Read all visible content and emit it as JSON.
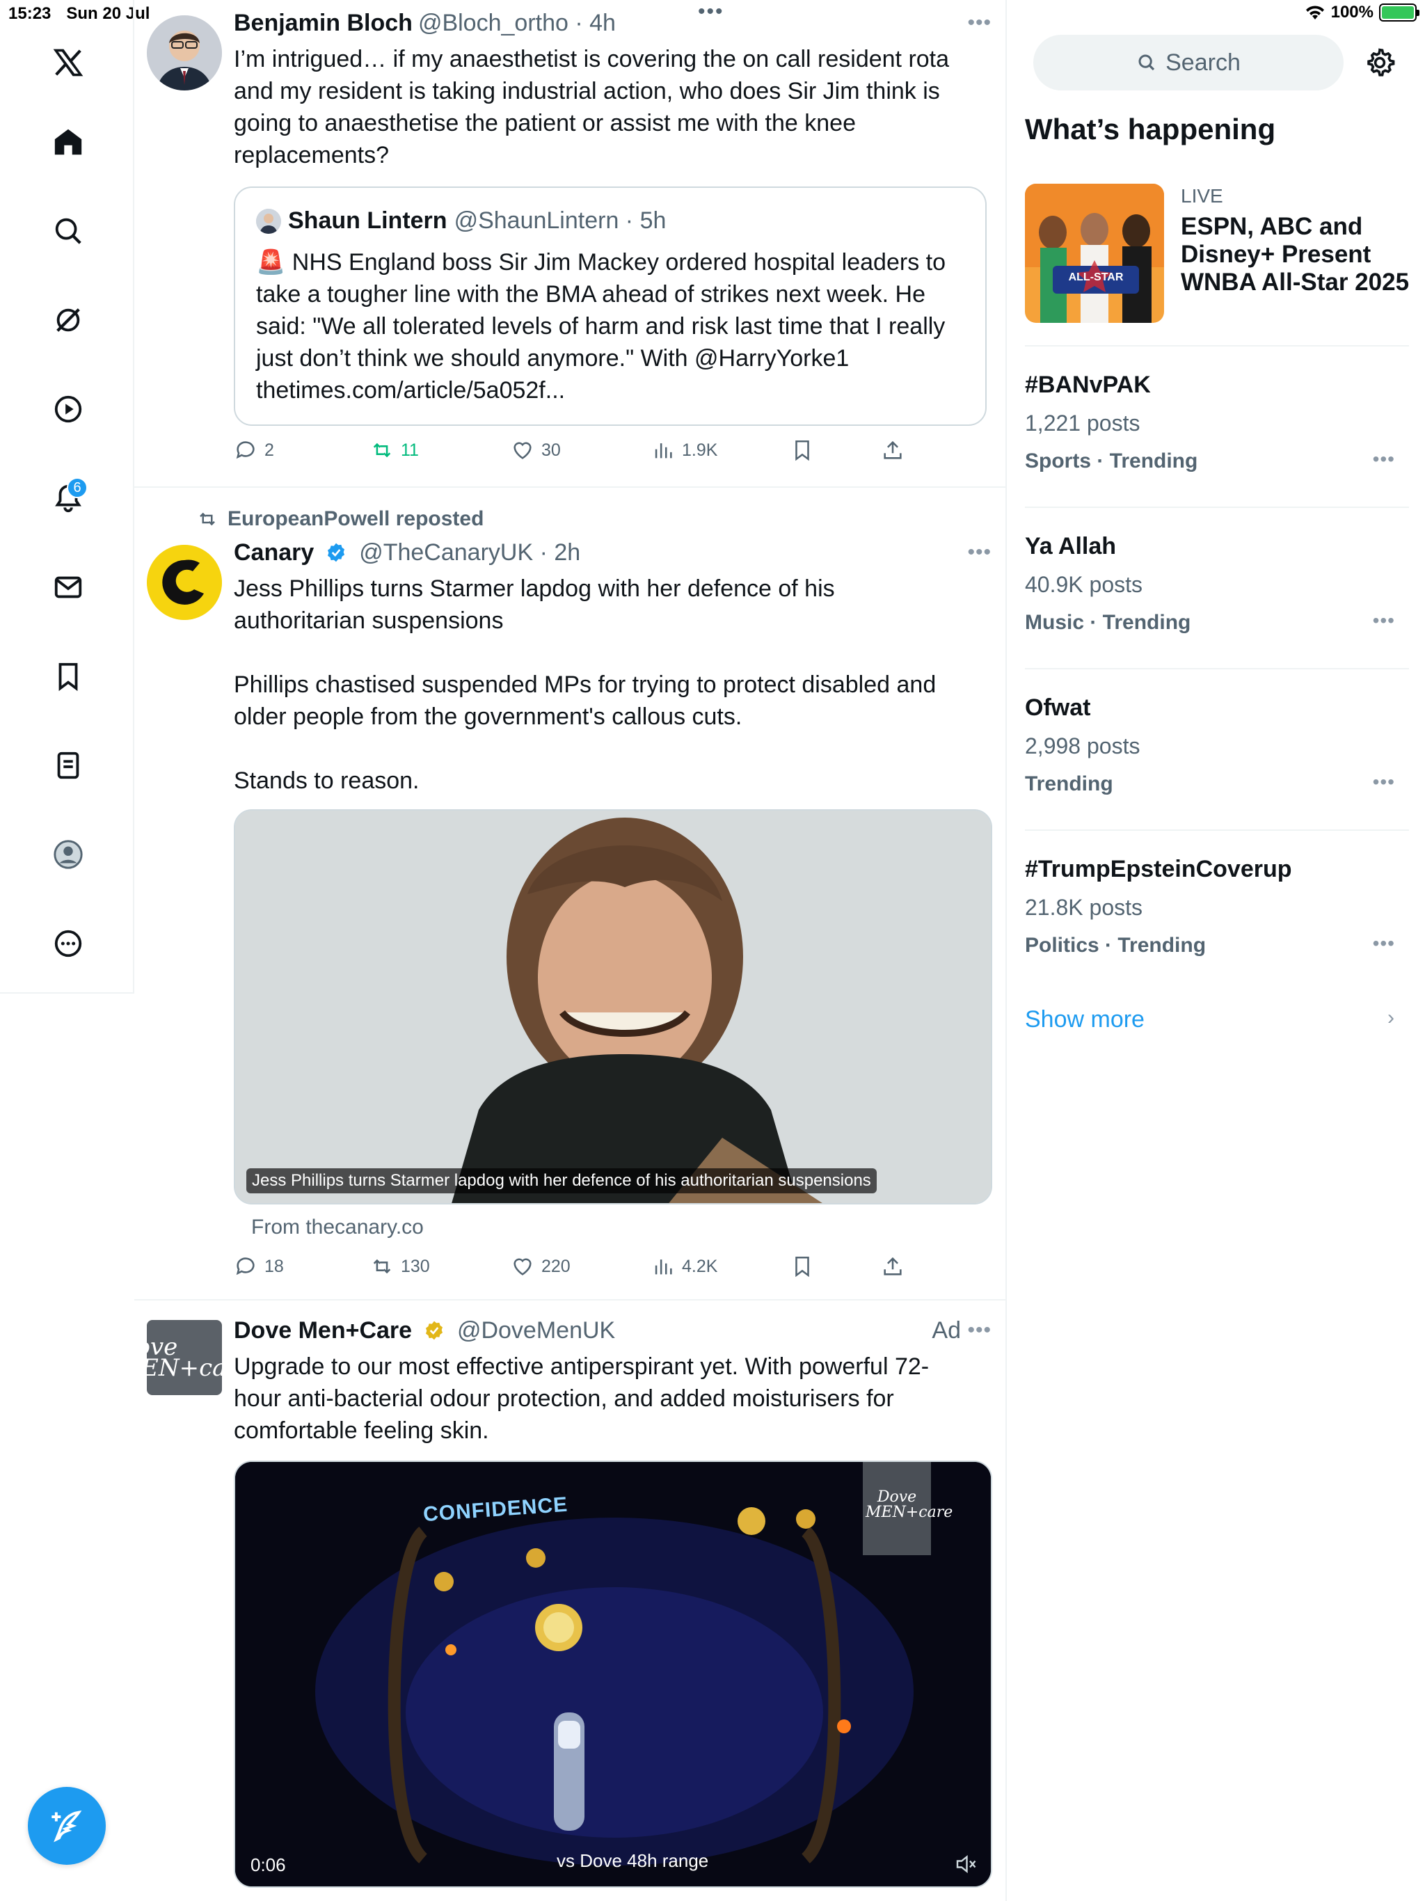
{
  "status_bar": {
    "time": "15:23",
    "date": "Sun 20 Jul",
    "battery": "100%"
  },
  "colors": {
    "accent": "#1d9bf0",
    "repost_green": "#00ba7c",
    "text": "#0f1419",
    "muted": "#536471"
  },
  "nav": {
    "items": [
      {
        "name": "x-logo-icon"
      },
      {
        "name": "home-icon"
      },
      {
        "name": "search-icon"
      },
      {
        "name": "grok-icon"
      },
      {
        "name": "video-icon"
      },
      {
        "name": "notifications-icon",
        "badge": "6"
      },
      {
        "name": "messages-icon"
      },
      {
        "name": "bookmarks-icon"
      },
      {
        "name": "lists-icon"
      },
      {
        "name": "profile-icon"
      },
      {
        "name": "more-icon"
      }
    ],
    "compose_icon": "compose-post-icon"
  },
  "feed": {
    "post1": {
      "name": "Benjamin Bloch",
      "handle": "@Bloch_ortho",
      "time": "4h",
      "text": "I’m intrigued… if my anaesthetist is covering the on call resident rota and my resident is taking industrial action, who does Sir Jim think is going to anaesthetise the patient or assist me with the knee replacements?",
      "quote": {
        "name": "Shaun Lintern",
        "handle": "@ShaunLintern",
        "time": "5h",
        "text": "🚨 NHS England boss Sir Jim Mackey ordered hospital leaders to take a tougher line with the BMA ahead of strikes next week. He said: \"We all tolerated levels of harm and risk last time that I really just don’t think we should anymore.\" With @HarryYorke1 thetimes.com/article/5a052f..."
      },
      "replies": "2",
      "reposts": "11",
      "likes": "30",
      "views": "1.9K"
    },
    "post2": {
      "reposted_by": "EuropeanPowell reposted",
      "name": "Canary",
      "handle": "@TheCanaryUK",
      "time": "2h",
      "text": "Jess Phillips turns Starmer lapdog with her defence of his authoritarian suspensions\n\nPhillips chastised suspended MPs for trying to protect disabled and older people from the government's callous cuts.\n\nStands to reason.",
      "media_caption": "Jess Phillips turns Starmer lapdog with her defence of his authoritarian suspensions",
      "from": "From thecanary.co",
      "replies": "18",
      "reposts": "130",
      "likes": "220",
      "views": "4.2K"
    },
    "post3": {
      "name": "Dove Men+Care",
      "handle": "@DoveMenUK",
      "ad_label": "Ad",
      "text": "Upgrade to our most effective antiperspirant yet. With powerful 72-hour anti-bacterial odour protection, and added moisturisers for comfortable feeling skin.",
      "logo_text": "Dove MEN+care",
      "video_title": "CONFIDENCE",
      "video_caption": "vs Dove 48h range",
      "video_time": "0:06"
    }
  },
  "right": {
    "search_placeholder": "Search",
    "section_title": "What’s happening",
    "live": {
      "tag": "LIVE",
      "title": "ESPN, ABC and Disney+ Present WNBA All-Star 2025",
      "thumb_text": "ALL-STAR"
    },
    "trends": [
      {
        "name": "#BANvPAK",
        "count": "1,221 posts",
        "category": "Sports · Trending"
      },
      {
        "name": "Ya Allah",
        "count": "40.9K posts",
        "category": "Music · Trending"
      },
      {
        "name": "Ofwat",
        "count": "2,998 posts",
        "category": "Trending"
      },
      {
        "name": "#TrumpEpsteinCoverup",
        "count": "21.8K posts",
        "category": "Politics · Trending"
      }
    ],
    "show_more": "Show more"
  }
}
